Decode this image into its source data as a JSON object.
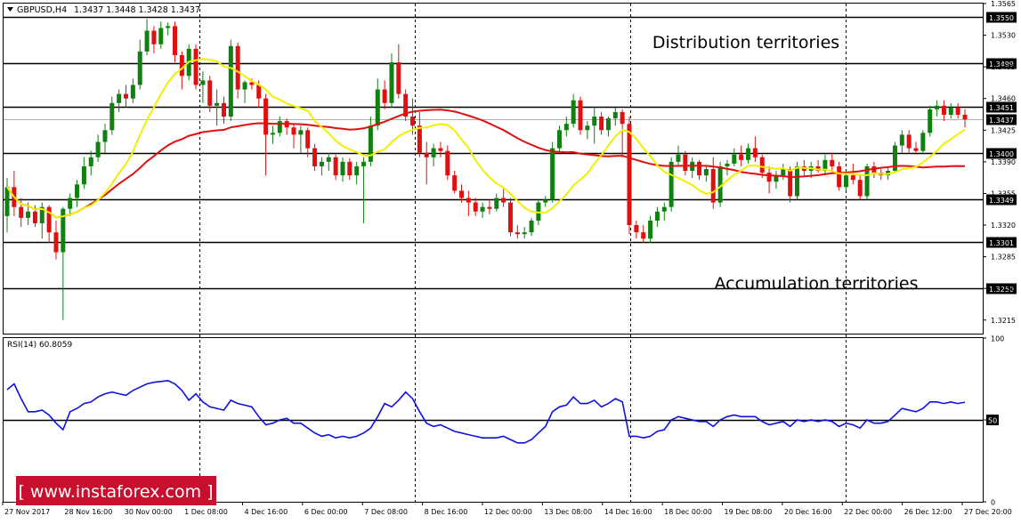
{
  "header": {
    "symbol": "GBPUSD,H4",
    "ohlc": "1.3437 1.3448 1.3428 1.3437"
  },
  "annotations": {
    "distribution": "Distribution territories",
    "accumulation": "Accumulation territories"
  },
  "watermark": "[ www.instaforex.com ]",
  "colors": {
    "bull": "#108010",
    "bear": "#e01010",
    "ma_fast": "#f0f000",
    "ma_slow": "#e01010",
    "rsi": "#1010e0",
    "watermark_bg": "#c8102e"
  },
  "chart_data": [
    {
      "type": "candlestick",
      "ylim": [
        1.32,
        1.3565
      ],
      "y_ticks": [
        "1.3565",
        "1.3530",
        "1.3495",
        "1.3460",
        "1.3425",
        "1.3390",
        "1.3355",
        "1.3320",
        "1.3285",
        "1.3250",
        "1.3215"
      ],
      "levels": [
        {
          "value": 1.355,
          "label": "1.3550"
        },
        {
          "value": 1.3499,
          "label": "1.3499"
        },
        {
          "value": 1.3451,
          "label": "1.3451"
        },
        {
          "value": 1.34,
          "label": "1.3400"
        },
        {
          "value": 1.3349,
          "label": "1.3349"
        },
        {
          "value": 1.3301,
          "label": "1.3301"
        },
        {
          "value": 1.325,
          "label": "1.3250"
        }
      ],
      "current_price": {
        "value": 1.3437,
        "label": "1.3437"
      },
      "x_labels": [
        "27 Nov 2017",
        "28 Nov 16:00",
        "30 Nov 00:00",
        "1 Dec 08:00",
        "4 Dec 16:00",
        "6 Dec 00:00",
        "7 Dec 08:00",
        "8 Dec 16:00",
        "12 Dec 00:00",
        "13 Dec 08:00",
        "14 Dec 16:00",
        "18 Dec 00:00",
        "19 Dec 08:00",
        "20 Dec 16:00",
        "22 Dec 00:00",
        "26 Dec 12:00",
        "27 Dec 20:00"
      ],
      "candles": [
        [
          1.333,
          1.3372,
          1.3312,
          1.3362
        ],
        [
          1.3362,
          1.338,
          1.333,
          1.334
        ],
        [
          1.334,
          1.335,
          1.3318,
          1.3328
        ],
        [
          1.3328,
          1.3345,
          1.332,
          1.3335
        ],
        [
          1.3335,
          1.3342,
          1.3318,
          1.3322
        ],
        [
          1.3322,
          1.3345,
          1.3305,
          1.334
        ],
        [
          1.334,
          1.3342,
          1.33,
          1.3312
        ],
        [
          1.3312,
          1.3325,
          1.3282,
          1.329
        ],
        [
          1.329,
          1.334,
          1.3215,
          1.3338
        ],
        [
          1.3338,
          1.3355,
          1.333,
          1.335
        ],
        [
          1.335,
          1.337,
          1.334,
          1.3365
        ],
        [
          1.3365,
          1.3395,
          1.336,
          1.3385
        ],
        [
          1.3385,
          1.3402,
          1.3375,
          1.3395
        ],
        [
          1.3395,
          1.342,
          1.339,
          1.3412
        ],
        [
          1.3412,
          1.3432,
          1.34,
          1.3425
        ],
        [
          1.3425,
          1.3462,
          1.342,
          1.3455
        ],
        [
          1.3455,
          1.347,
          1.3445,
          1.3465
        ],
        [
          1.3465,
          1.3475,
          1.345,
          1.346
        ],
        [
          1.346,
          1.3482,
          1.3455,
          1.3475
        ],
        [
          1.3475,
          1.3525,
          1.347,
          1.3512
        ],
        [
          1.3512,
          1.3548,
          1.3508,
          1.3535
        ],
        [
          1.3535,
          1.354,
          1.351,
          1.352
        ],
        [
          1.352,
          1.3545,
          1.3515,
          1.3538
        ],
        [
          1.3538,
          1.3544,
          1.353,
          1.354
        ],
        [
          1.354,
          1.3545,
          1.35,
          1.3508
        ],
        [
          1.3508,
          1.3512,
          1.347,
          1.3485
        ],
        [
          1.3485,
          1.352,
          1.348,
          1.3515
        ],
        [
          1.3515,
          1.352,
          1.347,
          1.3475
        ],
        [
          1.3475,
          1.349,
          1.3455,
          1.348
        ],
        [
          1.348,
          1.3485,
          1.3445,
          1.3452
        ],
        [
          1.3452,
          1.347,
          1.343,
          1.3455
        ],
        [
          1.3455,
          1.3462,
          1.3432,
          1.344
        ],
        [
          1.344,
          1.3525,
          1.3435,
          1.3518
        ],
        [
          1.3518,
          1.3522,
          1.346,
          1.347
        ],
        [
          1.347,
          1.348,
          1.3455,
          1.3478
        ],
        [
          1.3478,
          1.3482,
          1.347,
          1.3475
        ],
        [
          1.3475,
          1.348,
          1.345,
          1.346
        ],
        [
          1.346,
          1.3465,
          1.3375,
          1.342
        ],
        [
          1.342,
          1.343,
          1.341,
          1.3422
        ],
        [
          1.3422,
          1.344,
          1.3418,
          1.3435
        ],
        [
          1.3435,
          1.3438,
          1.342,
          1.3428
        ],
        [
          1.3428,
          1.3432,
          1.3405,
          1.342
        ],
        [
          1.342,
          1.343,
          1.34,
          1.3425
        ],
        [
          1.3425,
          1.3428,
          1.3395,
          1.3405
        ],
        [
          1.3405,
          1.341,
          1.338,
          1.3385
        ],
        [
          1.3385,
          1.3395,
          1.3375,
          1.339
        ],
        [
          1.339,
          1.34,
          1.338,
          1.3395
        ],
        [
          1.3395,
          1.3398,
          1.337,
          1.3375
        ],
        [
          1.3375,
          1.3395,
          1.3368,
          1.339
        ],
        [
          1.339,
          1.3394,
          1.337,
          1.3375
        ],
        [
          1.3375,
          1.339,
          1.3365,
          1.3385
        ],
        [
          1.3385,
          1.3395,
          1.3322,
          1.339
        ],
        [
          1.339,
          1.344,
          1.3385,
          1.343
        ],
        [
          1.343,
          1.3482,
          1.3425,
          1.347
        ],
        [
          1.347,
          1.348,
          1.3448,
          1.3455
        ],
        [
          1.3455,
          1.351,
          1.345,
          1.35
        ],
        [
          1.35,
          1.352,
          1.346,
          1.3465
        ],
        [
          1.3465,
          1.347,
          1.3435,
          1.344
        ],
        [
          1.344,
          1.346,
          1.342,
          1.343
        ],
        [
          1.343,
          1.3445,
          1.3395,
          1.34
        ],
        [
          1.34,
          1.3412,
          1.3365,
          1.3395
        ],
        [
          1.3395,
          1.341,
          1.3385,
          1.3405
        ],
        [
          1.3405,
          1.3412,
          1.3395,
          1.3402
        ],
        [
          1.3402,
          1.3408,
          1.337,
          1.3375
        ],
        [
          1.3375,
          1.338,
          1.3355,
          1.3358
        ],
        [
          1.3358,
          1.3365,
          1.3345,
          1.335
        ],
        [
          1.335,
          1.3358,
          1.333,
          1.3345
        ],
        [
          1.3345,
          1.335,
          1.333,
          1.3335
        ],
        [
          1.3335,
          1.3345,
          1.3328,
          1.334
        ],
        [
          1.334,
          1.3348,
          1.3332,
          1.3338
        ],
        [
          1.3338,
          1.3355,
          1.3335,
          1.335
        ],
        [
          1.335,
          1.336,
          1.334,
          1.3345
        ],
        [
          1.3345,
          1.335,
          1.3308,
          1.3312
        ],
        [
          1.3312,
          1.332,
          1.3305,
          1.331
        ],
        [
          1.331,
          1.3318,
          1.3305,
          1.3312
        ],
        [
          1.3312,
          1.3328,
          1.3308,
          1.3325
        ],
        [
          1.3325,
          1.3348,
          1.332,
          1.3345
        ],
        [
          1.3345,
          1.3352,
          1.334,
          1.3348
        ],
        [
          1.3348,
          1.3412,
          1.3345,
          1.3405
        ],
        [
          1.3405,
          1.343,
          1.34,
          1.3425
        ],
        [
          1.3425,
          1.344,
          1.3418,
          1.3432
        ],
        [
          1.3432,
          1.3465,
          1.3428,
          1.3458
        ],
        [
          1.3458,
          1.3462,
          1.342,
          1.3425
        ],
        [
          1.3425,
          1.3435,
          1.3415,
          1.343
        ],
        [
          1.343,
          1.345,
          1.341,
          1.344
        ],
        [
          1.344,
          1.3445,
          1.342,
          1.3425
        ],
        [
          1.3425,
          1.344,
          1.3418,
          1.3438
        ],
        [
          1.3438,
          1.345,
          1.343,
          1.3445
        ],
        [
          1.3445,
          1.3448,
          1.3395,
          1.3432
        ],
        [
          1.3432,
          1.344,
          1.331,
          1.332
        ],
        [
          1.332,
          1.3325,
          1.3305,
          1.3312
        ],
        [
          1.3312,
          1.332,
          1.33,
          1.3305
        ],
        [
          1.3305,
          1.333,
          1.33,
          1.3325
        ],
        [
          1.3325,
          1.334,
          1.3318,
          1.3335
        ],
        [
          1.3335,
          1.3345,
          1.3325,
          1.334
        ],
        [
          1.334,
          1.3395,
          1.3335,
          1.339
        ],
        [
          1.339,
          1.3408,
          1.3385,
          1.3398
        ],
        [
          1.3398,
          1.3402,
          1.3375,
          1.338
        ],
        [
          1.338,
          1.3395,
          1.3372,
          1.339
        ],
        [
          1.339,
          1.3392,
          1.337,
          1.3375
        ],
        [
          1.3375,
          1.3385,
          1.3368,
          1.3382
        ],
        [
          1.3382,
          1.3395,
          1.3338,
          1.3345
        ],
        [
          1.3345,
          1.339,
          1.334,
          1.3385
        ],
        [
          1.3385,
          1.3392,
          1.3375,
          1.3388
        ],
        [
          1.3388,
          1.3405,
          1.3385,
          1.3398
        ],
        [
          1.3398,
          1.3408,
          1.3385,
          1.3392
        ],
        [
          1.3392,
          1.341,
          1.3388,
          1.3405
        ],
        [
          1.3405,
          1.3418,
          1.339,
          1.3395
        ],
        [
          1.3395,
          1.3398,
          1.3372,
          1.3378
        ],
        [
          1.3378,
          1.3385,
          1.3355,
          1.3368
        ],
        [
          1.3368,
          1.338,
          1.336,
          1.3375
        ],
        [
          1.3375,
          1.3388,
          1.337,
          1.3382
        ],
        [
          1.3382,
          1.3385,
          1.3345,
          1.3352
        ],
        [
          1.3352,
          1.339,
          1.3348,
          1.3385
        ],
        [
          1.3385,
          1.3392,
          1.3375,
          1.338
        ],
        [
          1.338,
          1.339,
          1.3372,
          1.3385
        ],
        [
          1.3385,
          1.3392,
          1.3378,
          1.338
        ],
        [
          1.338,
          1.3398,
          1.3375,
          1.3392
        ],
        [
          1.3392,
          1.34,
          1.3378,
          1.3385
        ],
        [
          1.3385,
          1.339,
          1.3358,
          1.3362
        ],
        [
          1.3362,
          1.338,
          1.3358,
          1.3375
        ],
        [
          1.3375,
          1.3388,
          1.3365,
          1.337
        ],
        [
          1.337,
          1.3375,
          1.3348,
          1.3352
        ],
        [
          1.3352,
          1.3388,
          1.3348,
          1.3385
        ],
        [
          1.3385,
          1.339,
          1.3372,
          1.3378
        ],
        [
          1.3378,
          1.3382,
          1.337,
          1.3375
        ],
        [
          1.3375,
          1.3385,
          1.337,
          1.338
        ],
        [
          1.338,
          1.3412,
          1.3378,
          1.3408
        ],
        [
          1.3408,
          1.3425,
          1.34,
          1.342
        ],
        [
          1.342,
          1.3425,
          1.34,
          1.3405
        ],
        [
          1.3405,
          1.3412,
          1.3398,
          1.3402
        ],
        [
          1.3402,
          1.3425,
          1.3398,
          1.3422
        ],
        [
          1.3422,
          1.3452,
          1.3418,
          1.3448
        ],
        [
          1.3448,
          1.3458,
          1.344,
          1.3452
        ],
        [
          1.3452,
          1.3458,
          1.3435,
          1.3442
        ],
        [
          1.3442,
          1.3455,
          1.3438,
          1.345
        ],
        [
          1.345,
          1.3455,
          1.3438,
          1.3442
        ],
        [
          1.3442,
          1.3448,
          1.3428,
          1.3437
        ]
      ],
      "ma_fast_period": 12,
      "ma_slow_period": 50
    },
    {
      "type": "line",
      "label": "RSI(14) 60.8059",
      "ylim": [
        0,
        100
      ],
      "y_ticks": [
        "100",
        "50",
        "0"
      ],
      "level": 50,
      "values": [
        68.5,
        72.0,
        63.0,
        55.0,
        55.0,
        56.0,
        53.0,
        48.0,
        44.0,
        55.0,
        57.0,
        60.0,
        61.0,
        64.0,
        66.0,
        67.0,
        66.0,
        65.0,
        68.0,
        70.0,
        72.0,
        73.0,
        73.5,
        74.0,
        72.0,
        68.0,
        62.0,
        66.0,
        61.0,
        58.0,
        57.0,
        56.0,
        62.0,
        60.0,
        59.0,
        58.0,
        52.0,
        47.0,
        48.0,
        50.0,
        51.0,
        48.0,
        48.0,
        45.0,
        42.0,
        40.0,
        41.0,
        39.0,
        40.0,
        39.0,
        40.0,
        42.0,
        45.0,
        52.0,
        60.0,
        58.0,
        62.0,
        67.0,
        63.0,
        55.0,
        48.0,
        46.0,
        47.0,
        45.0,
        43.0,
        42.0,
        41.0,
        40.0,
        39.0,
        39.0,
        39.0,
        40.0,
        38.0,
        36.0,
        36.0,
        38.0,
        42.0,
        46.0,
        55.0,
        58.0,
        59.0,
        64.0,
        60.0,
        60.0,
        62.0,
        58.0,
        60.0,
        63.0,
        61.0,
        40.0,
        40.0,
        39.0,
        40.0,
        43.0,
        44.0,
        50.0,
        52.0,
        51.0,
        50.0,
        49.0,
        49.0,
        46.0,
        50.0,
        52.0,
        53.0,
        52.0,
        52.0,
        52.0,
        49.0,
        47.0,
        48.0,
        49.0,
        46.0,
        50.0,
        49.0,
        50.0,
        49.0,
        50.0,
        49.0,
        46.0,
        48.0,
        47.0,
        45.0,
        50.0,
        48.0,
        48.0,
        49.0,
        53.0,
        57.0,
        56.0,
        55.0,
        57.0,
        61.0,
        61.0,
        60.0,
        61.0,
        60.0,
        60.8
      ]
    }
  ]
}
